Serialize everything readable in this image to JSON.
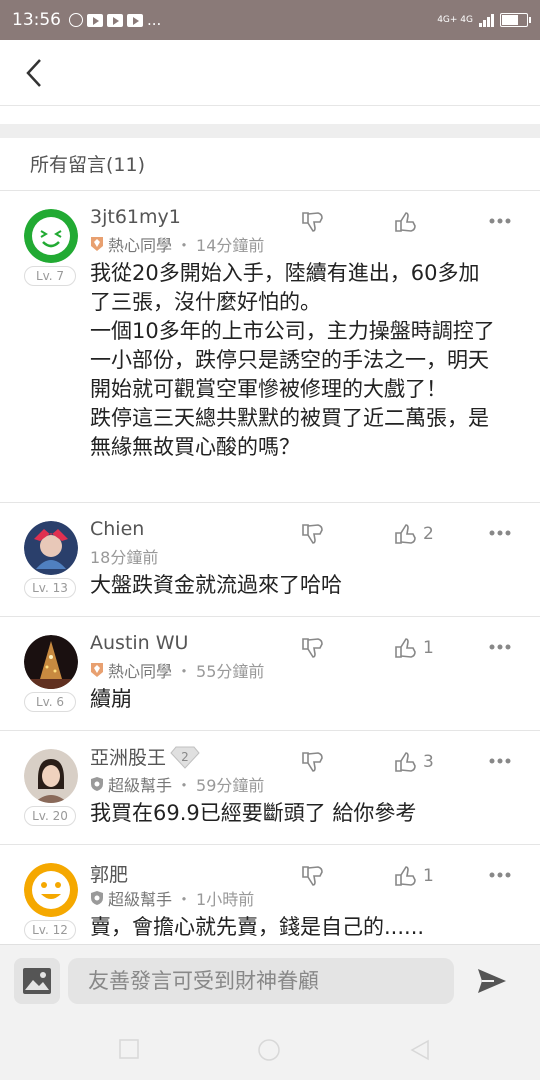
{
  "status_bar": {
    "time": "13:56",
    "network": "4G+ 4G",
    "ellipsis": "..."
  },
  "header": {
    "back_icon": "chevron-left-icon"
  },
  "section": {
    "title": "所有留言(11)"
  },
  "comments": [
    {
      "username": "3jt61my1",
      "level": "Lv. 7",
      "badge": "熱心同學",
      "badge_type": "hot-student",
      "time": "14分鐘前",
      "text": "我從20多開始入手，陸續有進出，60多加了三張，沒什麼好怕的。\n一個10多年的上市公司，主力操盤時調控了一小部份，跌停只是誘空的手法之一，明天開始就可觀賞空軍慘被修理的大戲了！\n跌停這三天總共默默的被買了近二萬張，是無緣無故買心酸的嗎？",
      "likes": ""
    },
    {
      "username": "Chien",
      "level": "Lv. 13",
      "badge": "",
      "time": "18分鐘前",
      "text": "大盤跌資金就流過來了哈哈",
      "likes": "2"
    },
    {
      "username": "Austin WU",
      "level": "Lv. 6",
      "badge": "熱心同學",
      "time": "55分鐘前",
      "text": "續崩",
      "likes": "1"
    },
    {
      "username": "亞洲股王",
      "level": "Lv. 20",
      "badge": "超級幫手",
      "time": "59分鐘前",
      "text": "我買在69.9已經要斷頭了 給你參考",
      "likes": "3",
      "diamond": "2"
    },
    {
      "username": "郭肥",
      "level": "Lv. 12",
      "badge": "超級幫手",
      "time": "1小時前",
      "text": "賣，會擔心就先賣，錢是自己的......",
      "likes": "1"
    }
  ],
  "composer": {
    "placeholder": "友善發言可受到財神眷顧",
    "image_icon": "image-icon",
    "send_icon": "send-icon"
  },
  "colors": {
    "status_bar": "#8a7a78",
    "hot_badge": "#e8a070",
    "super_badge": "#9a9a9a",
    "avatar_green": "#22aa33",
    "avatar_yellow": "#f5a800"
  }
}
